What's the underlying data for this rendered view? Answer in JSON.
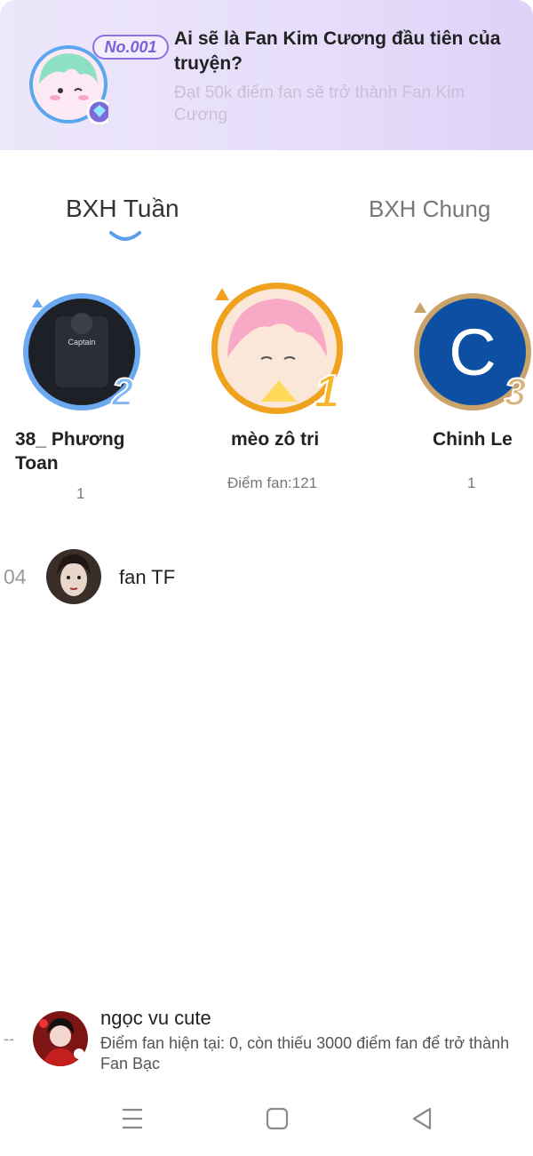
{
  "banner": {
    "badge": "No.001",
    "title": "Ai sẽ là Fan Kim Cương đầu tiên của truyện?",
    "subtitle": "Đạt 50k điểm fan sẽ trở thành Fan Kim Cương"
  },
  "tabs": [
    {
      "label": "BXH Tuần",
      "active": true
    },
    {
      "label": "BXH Chung",
      "active": false
    }
  ],
  "podium": [
    {
      "rank": 2,
      "name": "38_ Phương Toan",
      "score": "1",
      "avatar_text": "Captain"
    },
    {
      "rank": 1,
      "name": "mèo zô tri",
      "score": "Điểm fan:121"
    },
    {
      "rank": 3,
      "name": "Chinh Le",
      "score": "1",
      "avatar_letter": "C"
    }
  ],
  "list": [
    {
      "rank": "04",
      "name": "fan TF"
    }
  ],
  "me": {
    "rank": "--",
    "name": "ngọc vu cute",
    "note": "Điểm fan hiện tại: 0, còn thiếu 3000 điểm fan để trở thành Fan Bạc"
  },
  "colors": {
    "accent": "#5b9fe8",
    "gold": "#f0a21f",
    "silver": "#6aa8f0",
    "bronze": "#c9a36a"
  }
}
